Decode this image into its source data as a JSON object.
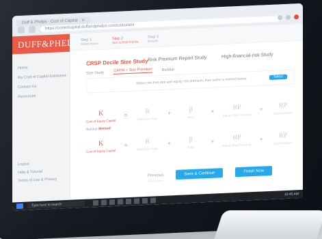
{
  "browser": {
    "tab_title": "Duff & Phelps - Cost of Capital",
    "url": "https://costofcapital.duffandphelps.com/calculator"
  },
  "app": {
    "brand": "DUFF&PHELPS",
    "sidebar": {
      "items": [
        "Home",
        "My Cost of Capital Estimates",
        "Contact Us",
        "Resources"
      ],
      "footer_items": [
        "Logout",
        "Help & Tutorial",
        "Terms of Use & Privacy"
      ]
    },
    "steps": [
      {
        "label": "Step 1",
        "sub": "Select Inputs"
      },
      {
        "label": "Step 2",
        "sub": "Size & Risk Premia"
      },
      {
        "label": "Step 3",
        "sub": "Results"
      }
    ],
    "headlines": {
      "left": "CRSP Decile Size Study",
      "middle": "Risk Premium Report Study",
      "right": "High-financial-risk Study"
    },
    "subtabs": [
      "Size Study",
      "CAPM + Size Premium",
      "Buildup"
    ],
    "panel_text": "Select risk-free rate and equity risk premium, then select a method below",
    "panel_button": "Select",
    "formula_labels": {
      "buildup_label": "Buildup",
      "buildup_method": "Method"
    },
    "formula_row1": [
      {
        "sym": "K",
        "cap": "Cost of Equity Capital",
        "style": "red"
      },
      {
        "sym": "=",
        "cap": "",
        "style": "op"
      },
      {
        "sym": "R",
        "cap": "Risk-Free Rate",
        "style": "muted"
      },
      {
        "sym": "+",
        "cap": "",
        "style": "op"
      },
      {
        "sym": "β",
        "cap": "Beta",
        "style": "muted"
      },
      {
        "sym": "×",
        "cap": "",
        "style": "op"
      },
      {
        "sym": "RP",
        "cap": "Equity Risk Premium",
        "style": "muted"
      },
      {
        "sym": "+",
        "cap": "",
        "style": "op"
      },
      {
        "sym": "RP",
        "cap": "Size Premium",
        "style": "muted"
      }
    ],
    "formula_row2": [
      {
        "sym": "K",
        "cap": "Cost of Equity Capital",
        "style": "red"
      },
      {
        "sym": "=",
        "cap": "",
        "style": "op"
      },
      {
        "sym": "R",
        "cap": "Risk-Free Rate",
        "style": "muted"
      },
      {
        "sym": "+",
        "cap": "",
        "style": "op"
      },
      {
        "sym": "β",
        "cap": "Beta",
        "style": "muted"
      },
      {
        "sym": "+",
        "cap": "",
        "style": "op"
      },
      {
        "sym": "RP",
        "cap": "Equity Risk Premium",
        "style": "muted"
      },
      {
        "sym": "+",
        "cap": "",
        "style": "op"
      },
      {
        "sym": "RP",
        "cap": "Size Premium",
        "style": "muted"
      }
    ],
    "actions": {
      "back": "Previous",
      "save": "Save & Continue",
      "finish": "Finish Now"
    }
  },
  "taskbar": {
    "search_placeholder": "Type here to search",
    "tray_text": "10:45 AM"
  },
  "colors": {
    "brand_red": "#e55a4a",
    "accent_blue": "#2aa7e8",
    "monitor_dark": "#151a20"
  }
}
